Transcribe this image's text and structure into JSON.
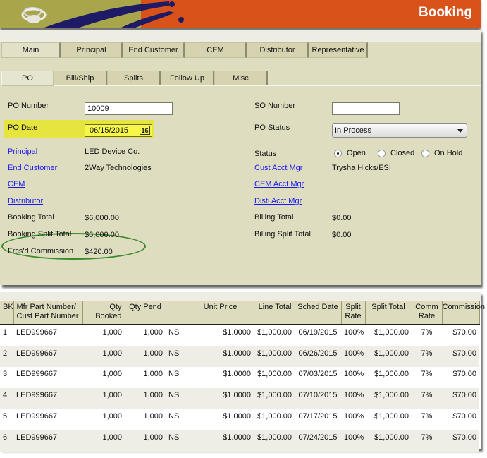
{
  "header": {
    "title": "Booking",
    "logo_icon": "swirl-logo-icon",
    "colors": {
      "banner": "#d9521a",
      "olive": "#a9a54b",
      "navy": "#1d1a66"
    }
  },
  "main_tabs": [
    {
      "label": "Main",
      "active": true
    },
    {
      "label": "Principal"
    },
    {
      "label": "End Customer"
    },
    {
      "label": "CEM"
    },
    {
      "label": "Distributor"
    },
    {
      "label": "Representative"
    }
  ],
  "sub_tabs": [
    {
      "label": "PO",
      "active": true
    },
    {
      "label": "Bill/Ship"
    },
    {
      "label": "Splits"
    },
    {
      "label": "Follow Up"
    },
    {
      "label": "Misc"
    }
  ],
  "form": {
    "po_number_label": "PO Number",
    "po_number_value": "10009",
    "po_date_label": "PO Date",
    "po_date_value": "06/15/2015",
    "calendar_icon_text": "16",
    "principal_label": "Principal",
    "principal_value": "LED Device Co.",
    "end_customer_label": "End Customer",
    "end_customer_value": "2Way Technologies",
    "cem_label": "CEM",
    "distributor_label": "Distributor",
    "booking_total_label": "Booking Total",
    "booking_total_value": "$6,000.00",
    "booking_split_total_label": "Booking Split Total",
    "booking_split_total_value": "$6,000.00",
    "frcsd_commission_label": "Frcs'd Commission",
    "frcsd_commission_value": "$420.00",
    "so_number_label": "SO Number",
    "so_number_value": "",
    "po_status_label": "PO Status",
    "po_status_value": "In Process",
    "status_label": "Status",
    "status_options": [
      "Open",
      "Closed",
      "On Hold"
    ],
    "status_selected": "Open",
    "cust_acct_mgr_label": "Cust Acct Mgr",
    "cust_acct_mgr_value": "Trysha Hicks/ESI",
    "cem_acct_mgr_label": "CEM Acct Mgr",
    "disti_acct_mgr_label": "Disti Acct Mgr",
    "billing_total_label": "Billing Total",
    "billing_total_value": "$0.00",
    "billing_split_total_label": "Billing Split Total",
    "billing_split_total_value": "$0.00"
  },
  "grid": {
    "columns": [
      "BK",
      "Mfr Part Number/\nCust Part Number",
      "Qty Booked",
      "Qty Pend",
      "",
      "Unit Price",
      "Line Total",
      "Sched Date",
      "Split\nRate",
      "Split Total",
      "Comm\nRate",
      "Commission"
    ],
    "rows": [
      [
        "1",
        "LED999667",
        "1,000",
        "1,000",
        "NS",
        "$1.0000",
        "$1,000.00",
        "06/19/2015",
        "100%",
        "$1,000.00",
        "7%",
        "$70.00"
      ],
      [
        "2",
        "LED999667",
        "1,000",
        "1,000",
        "NS",
        "$1.0000",
        "$1,000.00",
        "06/26/2015",
        "100%",
        "$1,000.00",
        "7%",
        "$70.00"
      ],
      [
        "3",
        "LED999667",
        "1,000",
        "1,000",
        "NS",
        "$1.0000",
        "$1,000.00",
        "07/03/2015",
        "100%",
        "$1,000.00",
        "7%",
        "$70.00"
      ],
      [
        "4",
        "LED999667",
        "1,000",
        "1,000",
        "NS",
        "$1.0000",
        "$1,000.00",
        "07/10/2015",
        "100%",
        "$1,000.00",
        "7%",
        "$70.00"
      ],
      [
        "5",
        "LED999667",
        "1,000",
        "1,000",
        "NS",
        "$1.0000",
        "$1,000.00",
        "07/17/2015",
        "100%",
        "$1,000.00",
        "7%",
        "$70.00"
      ],
      [
        "6",
        "LED999667",
        "1,000",
        "1,000",
        "NS",
        "$1.0000",
        "$1,000.00",
        "07/24/2015",
        "100%",
        "$1,000.00",
        "7%",
        "$70.00"
      ]
    ]
  }
}
